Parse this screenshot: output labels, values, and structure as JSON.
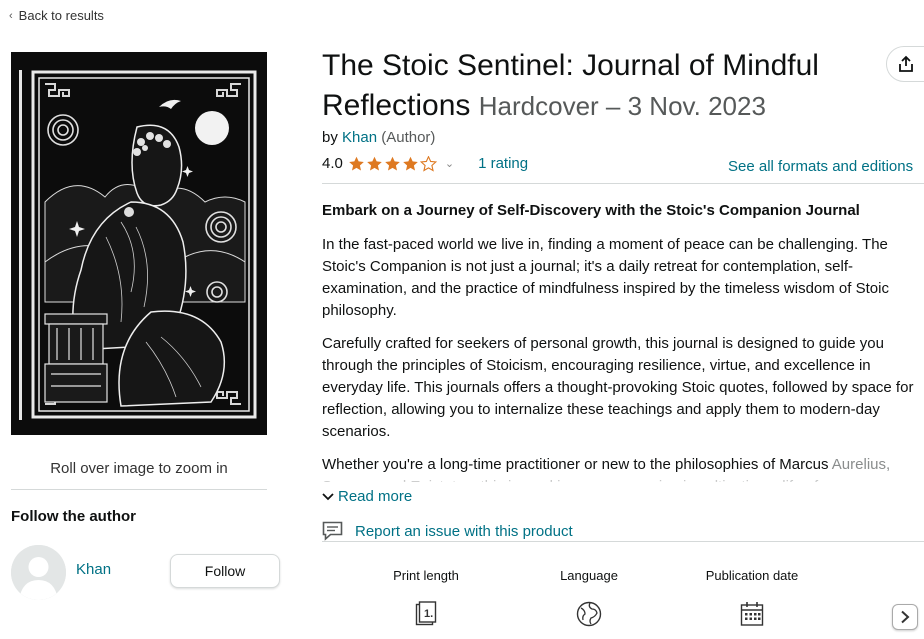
{
  "nav": {
    "back_label": "Back to results"
  },
  "product": {
    "title": "The Stoic Sentinel: Journal of Mindful Reflections",
    "format": "Hardcover",
    "date_sep": "–",
    "date": "3 Nov. 2023",
    "by_prefix": "by",
    "author": "Khan",
    "author_role": "(Author)",
    "rating_value": "4.0",
    "rating_stars": 4,
    "rating_count": "1 rating",
    "formats_link": "See all formats and editions"
  },
  "image": {
    "zoom_hint": "Roll over image to zoom in"
  },
  "follow": {
    "title": "Follow the author",
    "author_name": "Khan",
    "button_label": "Follow"
  },
  "description": {
    "headline": "Embark on a Journey of Self-Discovery with the Stoic's Companion Journal",
    "p1": "In the fast-paced world we live in, finding a moment of peace can be challenging. The Stoic's Companion is not just a journal; it's a daily retreat for contemplation, self-examination, and the practice of mindfulness inspired by the timeless wisdom of Stoic philosophy.",
    "p2": "Carefully crafted for seekers of personal growth, this journal is designed to guide you through the principles of Stoicism, encouraging resilience, virtue, and excellence in everyday life. This journals offers a thought-provoking Stoic quotes, followed by space for reflection, allowing you to internalize these teachings and apply them to modern-day scenarios.",
    "p3": "Whether you're a long-time practitioner or new to the philosophies of Marcus",
    "p3_faded": "Aurelius, Seneca, and Epictetus, this journal is your companion in cultivating a life of",
    "read_more": "Read more"
  },
  "report": {
    "label": "Report an issue with this product"
  },
  "specs": [
    {
      "label": "Print length",
      "icon": "book-pages-icon"
    },
    {
      "label": "Language",
      "icon": "globe-icon"
    },
    {
      "label": "Publication date",
      "icon": "calendar-icon"
    }
  ],
  "colors": {
    "link": "#007185",
    "star": "#de7921",
    "text": "#0f1111",
    "muted": "#565959"
  }
}
